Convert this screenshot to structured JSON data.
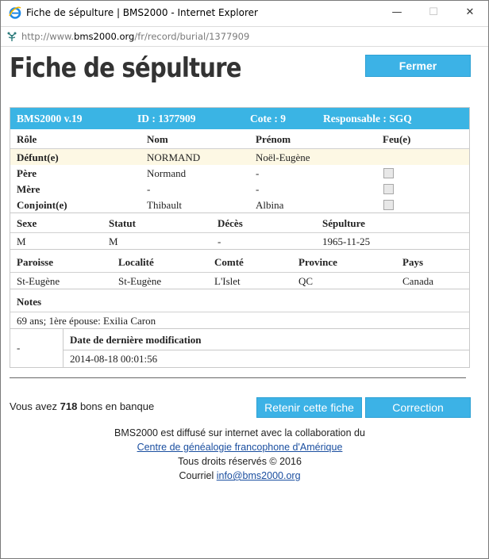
{
  "window": {
    "title": "Fiche de sépulture | BMS2000 - Internet Explorer",
    "minimize_glyph": "—",
    "maximize_glyph": "☐",
    "close_glyph": "✕",
    "url_scheme": "http://www.",
    "url_host": "bms2000.org",
    "url_path": "/fr/record/burial/1377909"
  },
  "page": {
    "title": "Fiche de sépulture",
    "close_button": "Fermer"
  },
  "record": {
    "header": {
      "version": "BMS2000 v.19",
      "id": "ID : 1377909",
      "cote": "Cote : 9",
      "responsable": "Responsable : SGQ"
    },
    "people_columns": [
      "Rôle",
      "Nom",
      "Prénom",
      "Feu(e)"
    ],
    "people": [
      {
        "role": "Défunt(e)",
        "nom": "NORMAND",
        "prenom": "Noël-Eugène"
      },
      {
        "role": "Père",
        "nom": "Normand",
        "prenom": "-"
      },
      {
        "role": "Mère",
        "nom": "-",
        "prenom": "-"
      },
      {
        "role": "Conjoint(e)",
        "nom": "Thibault",
        "prenom": "Albina"
      }
    ],
    "vital_columns": [
      "Sexe",
      "Statut",
      "Décès",
      "Sépulture"
    ],
    "vital": {
      "sexe": "M",
      "statut": "M",
      "deces": "-",
      "sepulture": "1965-11-25"
    },
    "place_columns": [
      "Paroisse",
      "Localité",
      "Comté",
      "Province",
      "Pays"
    ],
    "place": {
      "paroisse": "St-Eugène",
      "localite": "St-Eugène",
      "comte": "L'Islet",
      "province": "QC",
      "pays": "Canada"
    },
    "notes_label": "Notes",
    "notes": "69 ans; 1ère épouse: Exilia Caron",
    "modif_left": "-",
    "modif_label": "Date de dernière modification",
    "modif_date": "2014-08-18 00:01:56"
  },
  "bank": {
    "prefix": "Vous avez",
    "count": "718",
    "suffix": "bons en banque"
  },
  "actions": {
    "retain": "Retenir cette fiche",
    "correction": "Correction"
  },
  "footer": {
    "line1": "BMS2000 est diffusé sur internet avec la collaboration du",
    "partner_link": "Centre de généalogie francophone d'Amérique",
    "rights": "Tous droits réservés © 2016",
    "mail_prefix": "Courriel",
    "mail_link": "info@bms2000.org"
  },
  "colors": {
    "accent": "#3ab4e4",
    "highlight_row": "#fdf8e4",
    "link": "#1b4fa0"
  },
  "icons": [
    "internet-explorer-icon",
    "page-icon",
    "checkbox"
  ]
}
